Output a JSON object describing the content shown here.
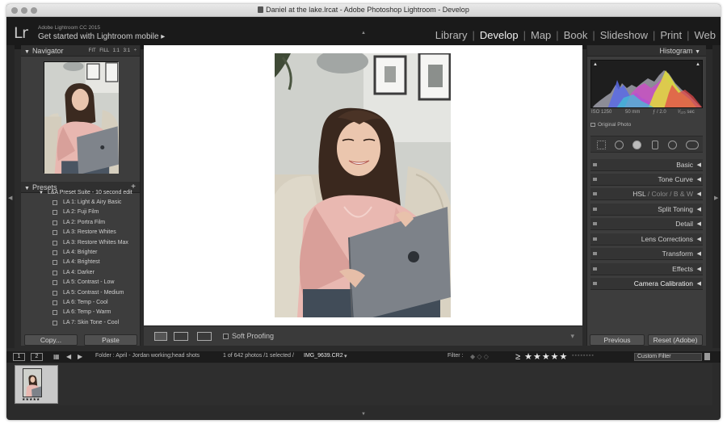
{
  "window": {
    "title": "Daniel at the lake.lrcat - Adobe Photoshop Lightroom - Develop"
  },
  "identity": {
    "logo": "Lr",
    "small": "Adobe Lightroom CC 2015",
    "big": "Get started with Lightroom mobile ▸"
  },
  "modules": [
    "Library",
    "Develop",
    "Map",
    "Book",
    "Slideshow",
    "Print",
    "Web"
  ],
  "active_module": "Develop",
  "navigator": {
    "title": "Navigator",
    "zoom": "FIT  FILL  1:1  3:1 ÷"
  },
  "presets": {
    "title": "Presets",
    "group": "L&A Preset Suite - 10 second edit",
    "items": [
      "LA 1: Light & Airy Basic",
      "LA 2: Fuji Film",
      "LA 2: Portra Film",
      "LA 3: Restore Whites",
      "LA 3: Restore Whites Max",
      "LA 4: Brighter",
      "LA 4: Brightest",
      "LA 4: Darker",
      "LA 5: Contrast - Low",
      "LA 5: Contrast - Medium",
      "LA 6: Temp - Cool",
      "LA 6: Temp - Warm",
      "LA 7: Skin Tone - Cool"
    ]
  },
  "left_buttons": {
    "copy": "Copy...",
    "paste": "Paste"
  },
  "toolbar": {
    "soft_proofing": "Soft Proofing"
  },
  "histogram": {
    "title": "Histogram",
    "iso": "ISO 1250",
    "focal": "50 mm",
    "aperture": "ƒ / 2.0",
    "shutter": "¹⁄₁₂₅ sec",
    "original_photo": "Original Photo"
  },
  "sections": [
    "Basic",
    "Tone Curve",
    "HSL / Color / B & W",
    "Split Toning",
    "Detail",
    "Lens Corrections",
    "Transform",
    "Effects",
    "Camera Calibration"
  ],
  "right_buttons": {
    "previous": "Previous",
    "reset": "Reset (Adobe)"
  },
  "filmstrip": {
    "page1": "1",
    "page2": "2",
    "folder": "Folder : April - Jordan working;head shots",
    "count": "1 of 642 photos /1 selected /",
    "filename": "IMG_9639.CR2",
    "filter_label": "Filter :",
    "stars": "≥ ★★★★★",
    "custom_filter": "Custom Filter",
    "thumb_stars": "★★★★★"
  },
  "colors": {
    "panel": "#3d3d3d",
    "topbar": "#1a1a1a",
    "active": "#f0f0f0"
  }
}
